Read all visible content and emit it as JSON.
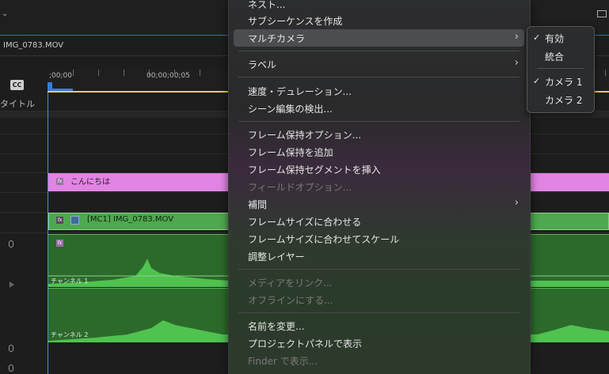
{
  "sequence": {
    "name": "IMG_0783.MOV"
  },
  "ruler": {
    "timecodes": [
      ";00;00",
      "00;00;00;05"
    ]
  },
  "tracks": {
    "title_label": "タイトル",
    "cc_label": "CC"
  },
  "clips": {
    "text_clip": "こんにちは",
    "multicam_clip": "[MC1] IMG_0783.MOV",
    "fx_label": "fx",
    "channel_1": "チャンネル 1",
    "channel_2": "チャンネル 2"
  },
  "menu": {
    "items": [
      {
        "label": "ネスト...",
        "disabled": false
      },
      {
        "label": "サブシーケンスを作成",
        "disabled": false
      },
      {
        "label": "マルチカメラ",
        "disabled": false,
        "submenu": true,
        "highlighted": true
      },
      {
        "label": "ラベル",
        "disabled": false,
        "submenu": true
      },
      {
        "label": "速度・デュレーション...",
        "disabled": false
      },
      {
        "label": "シーン編集の検出...",
        "disabled": false
      },
      {
        "label": "フレーム保持オプション...",
        "disabled": false
      },
      {
        "label": "フレーム保持を追加",
        "disabled": false
      },
      {
        "label": "フレーム保持セグメントを挿入",
        "disabled": false
      },
      {
        "label": "フィールドオプション...",
        "disabled": true
      },
      {
        "label": "補間",
        "disabled": false,
        "submenu": true
      },
      {
        "label": "フレームサイズに合わせる",
        "disabled": false
      },
      {
        "label": "フレームサイズに合わせてスケール",
        "disabled": false
      },
      {
        "label": "調整レイヤー",
        "disabled": false
      },
      {
        "label": "メディアをリンク...",
        "disabled": true
      },
      {
        "label": "オフラインにする...",
        "disabled": true
      },
      {
        "label": "名前を変更...",
        "disabled": false
      },
      {
        "label": "プロジェクトパネルで表示",
        "disabled": false
      },
      {
        "label": "Finder で表示...",
        "disabled": true
      }
    ],
    "submenu_chevron": "›"
  },
  "submenu": {
    "items": [
      {
        "label": "有効",
        "checked": true
      },
      {
        "label": "統合",
        "checked": false
      },
      {
        "label": "カメラ 1",
        "checked": true
      },
      {
        "label": "カメラ 2",
        "checked": false
      }
    ],
    "check_mark": "✓"
  },
  "colors": {
    "text_clip": "#e184e4",
    "multicam_clip": "#4fa84f",
    "audio_clip": "#2c6a2c",
    "playhead": "#2f7fe0",
    "work_area": "#e5d24a"
  },
  "icons": [
    "cc-icon",
    "fx-icon",
    "multicam-icon",
    "microphone-icon",
    "chevron-right-icon",
    "checkmark-icon"
  ]
}
